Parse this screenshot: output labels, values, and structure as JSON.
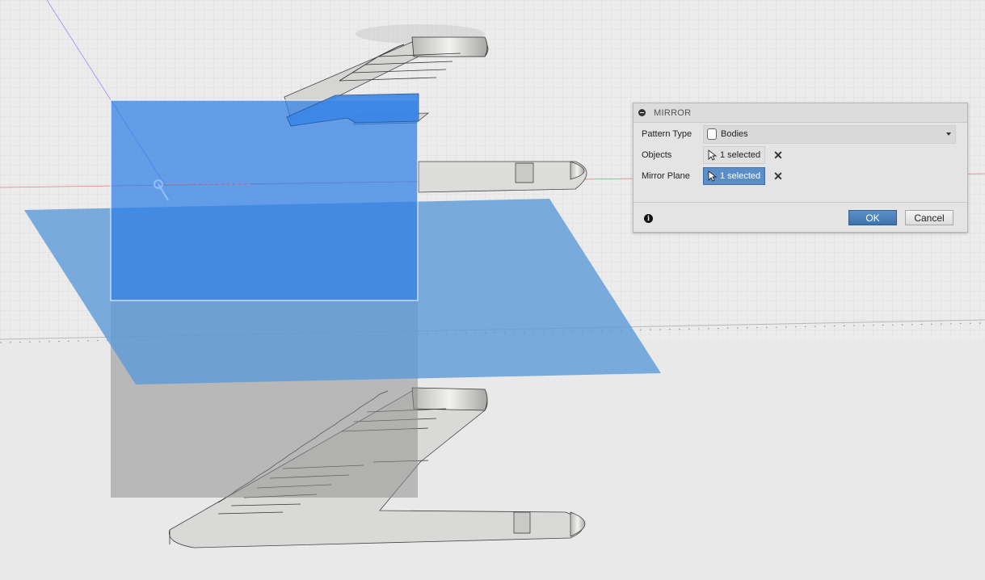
{
  "dialog": {
    "title": "MIRROR",
    "pattern_type": {
      "label": "Pattern Type",
      "value": "Bodies"
    },
    "objects": {
      "label": "Objects",
      "value": "1 selected"
    },
    "mirror_plane": {
      "label": "Mirror Plane",
      "value": "1 selected"
    },
    "ok_label": "OK",
    "cancel_label": "Cancel"
  },
  "icons": {
    "collapse": "collapse-icon",
    "body": "body-icon",
    "cursor": "cursor-icon",
    "clear": "clear-icon",
    "info": "info-icon"
  },
  "colors": {
    "selection_blue": "#2f7fe6",
    "plane_blue": "#5b9ad8",
    "ok_button": "#4a80bd",
    "active_field": "#5b8ec9"
  }
}
